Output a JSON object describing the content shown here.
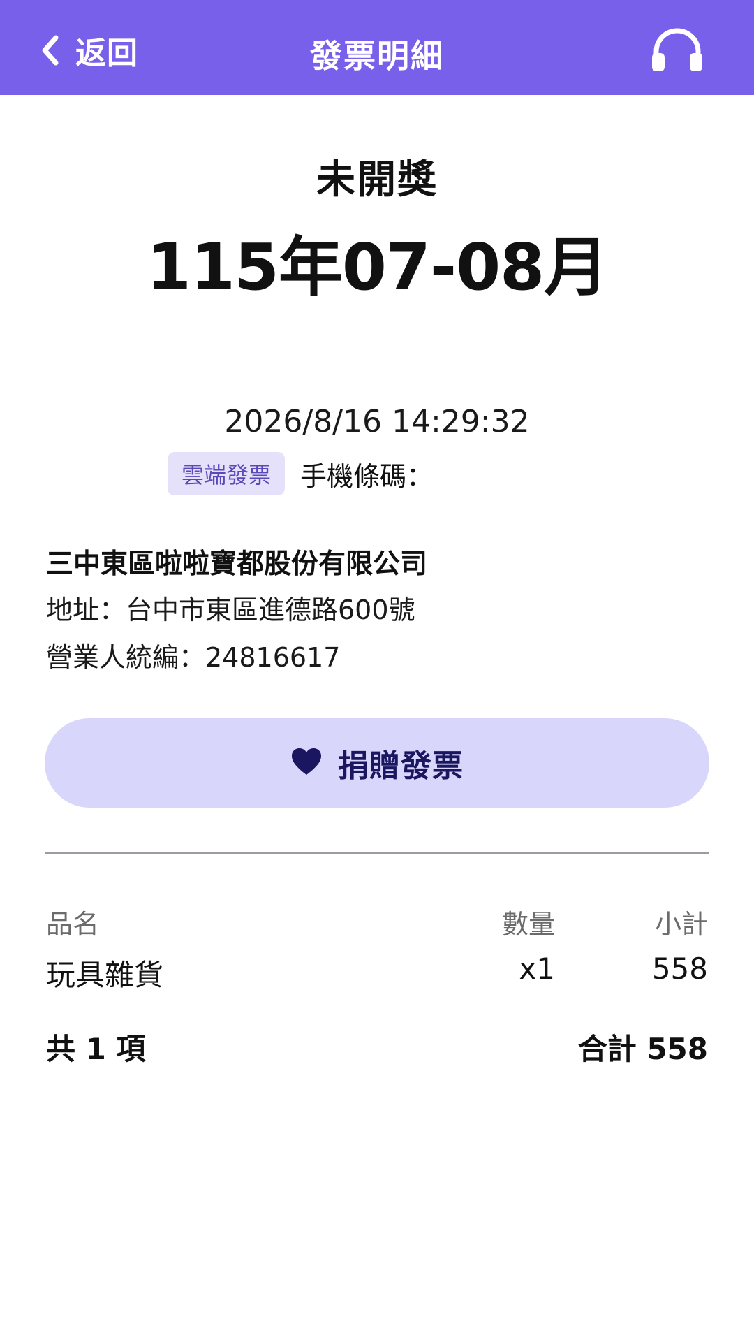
{
  "header": {
    "back_label": "返回",
    "title": "發票明細",
    "support_icon": "headset-icon",
    "background": "#7860ea"
  },
  "invoice": {
    "status": "未開獎",
    "period": "115年07-08月",
    "datetime": "2026/8/16 14:29:32",
    "carrier_tag": "雲端發票",
    "barcode_label": "手機條碼："
  },
  "seller": {
    "name": "三中東區啦啦寶都股份有限公司",
    "address": "地址：台中市東區進德路600號",
    "ban": "營業人統編：24816617"
  },
  "donate": {
    "label": "捐贈發票",
    "icon": "heart-icon",
    "background": "#d9d6fb"
  },
  "items": {
    "headers": {
      "name": "品名",
      "qty": "數量",
      "subtotal": "小計"
    },
    "rows": [
      {
        "name": "玩具雜貨",
        "qty": "x1",
        "subtotal": "558"
      }
    ],
    "total_count": "共 1 項",
    "total_amount": "合計 558"
  }
}
